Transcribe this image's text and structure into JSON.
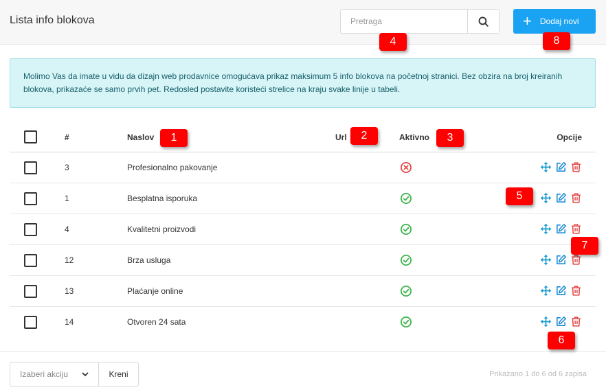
{
  "header": {
    "title": "Lista info blokova",
    "search_placeholder": "Pretraga",
    "add_label": "Dodaj novi"
  },
  "alert": {
    "text": "Molimo Vas da imate u vidu da dizajn web prodavnice omogućava prikaz maksimum 5 info blokova na početnoj stranici. Bez obzira na broj kreiranih blokova, prikazaće se samo prvih pet. Redosled postavite koristeći strelice na kraju svake linije u tabeli."
  },
  "table": {
    "columns": {
      "num": "#",
      "title": "Naslov",
      "url": "Url",
      "active": "Aktivno",
      "options": "Opcije"
    },
    "rows": [
      {
        "num": "3",
        "title": "Profesionalno pakovanje",
        "active": false
      },
      {
        "num": "1",
        "title": "Besplatna isporuka",
        "active": true
      },
      {
        "num": "4",
        "title": "Kvalitetni proizvodi",
        "active": true
      },
      {
        "num": "12",
        "title": "Brza usluga",
        "active": true
      },
      {
        "num": "13",
        "title": "Plaćanje online",
        "active": true
      },
      {
        "num": "14",
        "title": "Otvoren 24 sata",
        "active": true
      }
    ]
  },
  "footer": {
    "action_placeholder": "Izaberi akciju",
    "go_label": "Kreni",
    "paging_text": "Prikazano 1 do 6 od 6 zapisa"
  },
  "markers": [
    "1",
    "2",
    "3",
    "4",
    "5",
    "6",
    "7",
    "8"
  ],
  "colors": {
    "primary": "#1aa3f2",
    "success": "#3bb54a",
    "danger": "#e54848",
    "move": "#1a9bd0",
    "edit": "#1a8ad6",
    "alert_bg": "#d7f4f7",
    "marker": "#ff0000"
  },
  "icons": {
    "search": "search-icon",
    "add": "plus-icon",
    "move": "move-icon",
    "edit": "edit-icon",
    "delete": "trash-icon",
    "active": "check-circle-icon",
    "inactive": "x-circle-icon",
    "dropdown": "chevron-down-icon"
  }
}
